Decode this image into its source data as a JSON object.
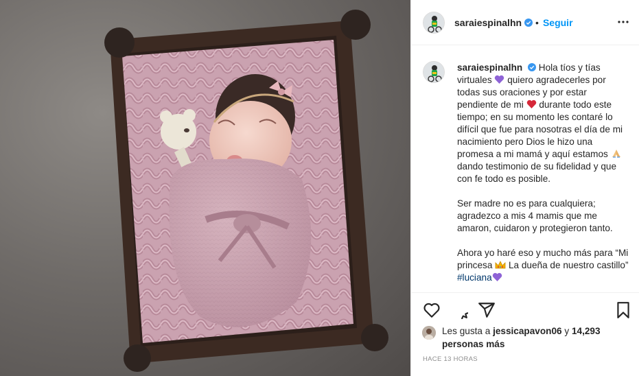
{
  "post": {
    "username": "saraiespinalhn",
    "verified": true,
    "separator": "•",
    "follow_label": "Seguir",
    "more_icon": "more-options-icon"
  },
  "caption": {
    "username": "saraiespinalhn",
    "p1_a": "Hola tíos y tías virtuales",
    "p1_b": "quiero agradecerles por todas sus oraciones y por estar pendiente de mi",
    "p1_c": "durante todo este tiempo; en su momento les contaré lo difícil que fue para nosotras el día de mi nacimiento pero Dios le hizo una promesa a mi mamá y aquí estamos",
    "p1_d": "dando testimonio de su fidelidad y que con fe todo es posible.",
    "p2": "Ser madre no es para cualquiera; agradezco a mis 4 mamis que me amaron, cuidaron y protegieron tanto.",
    "p3_a": "Ahora yo haré eso y mucho más para “Mi princesa",
    "p3_b": "La dueña de nuestro castillo”",
    "hashtag": "#luciana",
    "emojis": [
      "purple-heart-emoji",
      "red-heart-emoji",
      "praying-hands-emoji",
      "crown-emoji",
      "purple-heart-emoji"
    ]
  },
  "likes": {
    "prefix": "Les gusta a",
    "user": "jessicapavon06",
    "joiner": "y",
    "count": "14,293 personas más"
  },
  "timestamp": "HACE 13 HORAS",
  "colors": {
    "accent": "#0095f6",
    "verified": "#3897f0",
    "hashtag": "#00376b",
    "muted": "#8e8e8e",
    "purple_heart": "#8e63d6",
    "red_heart": "#d62839"
  }
}
